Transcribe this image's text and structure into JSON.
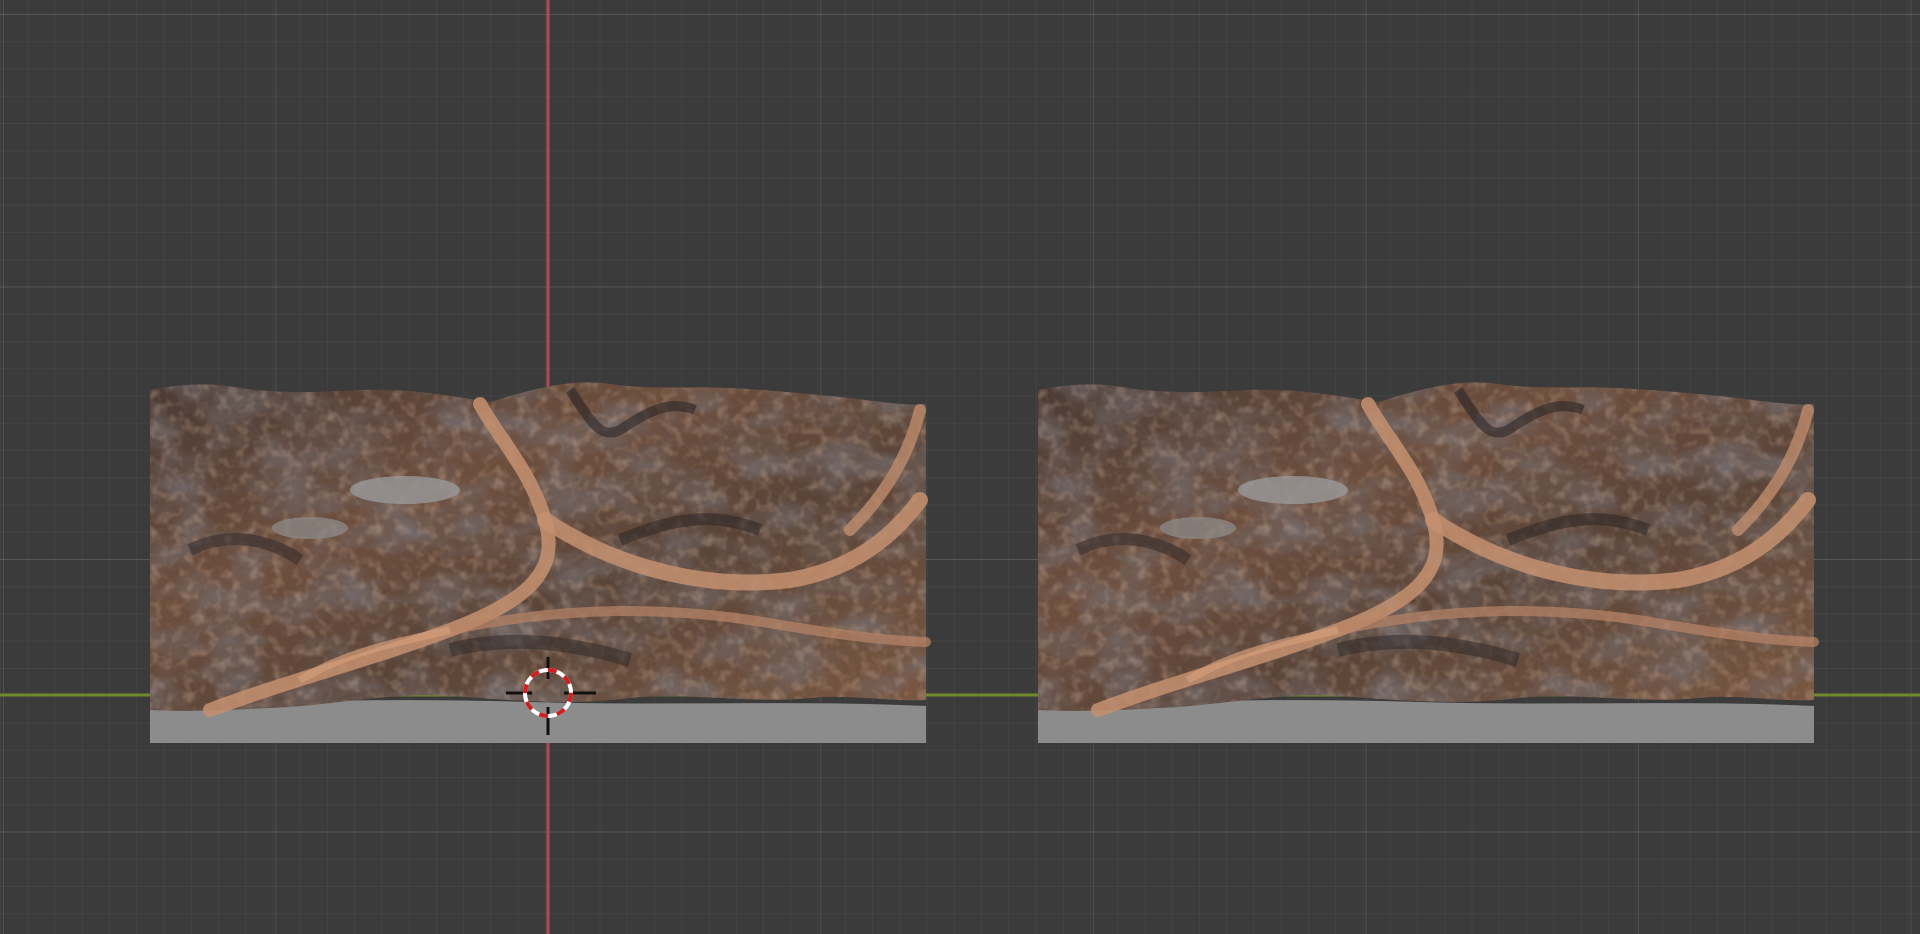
{
  "app": "3D viewport",
  "colors": {
    "background": "#3b3b3b",
    "grid_minor": "#454545",
    "grid_major": "#555555",
    "x_axis": "#7a8a2a",
    "y_axis": "#b8465a",
    "terrain_base": "#8a8a8a",
    "terrain_light": "#c08a62",
    "terrain_dark": "#2e2a2c"
  },
  "icons": {
    "cursor": "3d-cursor-icon"
  },
  "scene": {
    "objects": [
      {
        "name": "terrain-mesh-left",
        "kind": "terrain"
      },
      {
        "name": "terrain-mesh-right",
        "kind": "terrain"
      }
    ]
  }
}
